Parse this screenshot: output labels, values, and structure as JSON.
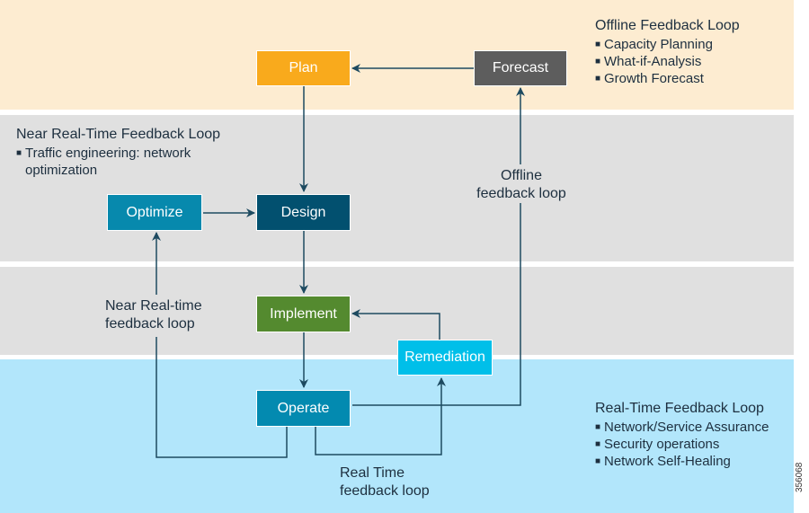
{
  "colors": {
    "plan": "#f9aa1c",
    "forecast": "#5d5d5d",
    "optimize": "#0789ad",
    "design": "#02506f",
    "implement": "#548a2f",
    "remediation": "#00bfe9",
    "operate": "#038ab0",
    "arrow": "#1d4a60",
    "band_offline": "#fdecd1",
    "band_near_real_time": "#e0e0e0",
    "band_real_time": "#b2e6fb"
  },
  "nodes": {
    "plan": "Plan",
    "forecast": "Forecast",
    "optimize": "Optimize",
    "design": "Design",
    "implement": "Implement",
    "remediation": "Remediation",
    "operate": "Operate"
  },
  "loop_labels": {
    "offline": [
      "Offline",
      "feedback loop"
    ],
    "near_real_time": [
      "Near Real-time",
      "feedback loop"
    ],
    "real_time": [
      "Real Time",
      "feedback loop"
    ]
  },
  "panels": {
    "offline": {
      "title": "Offline Feedback Loop",
      "items": [
        "Capacity Planning",
        "What-if-Analysis",
        "Growth Forecast"
      ]
    },
    "near_real_time": {
      "title": "Near Real-Time Feedback Loop",
      "items": [
        "Traffic engineering: network",
        "optimization"
      ]
    },
    "real_time": {
      "title": "Real-Time Feedback Loop",
      "items": [
        "Network/Service Assurance",
        "Security operations",
        "Network Self-Healing"
      ]
    }
  },
  "figure_id": "356068"
}
